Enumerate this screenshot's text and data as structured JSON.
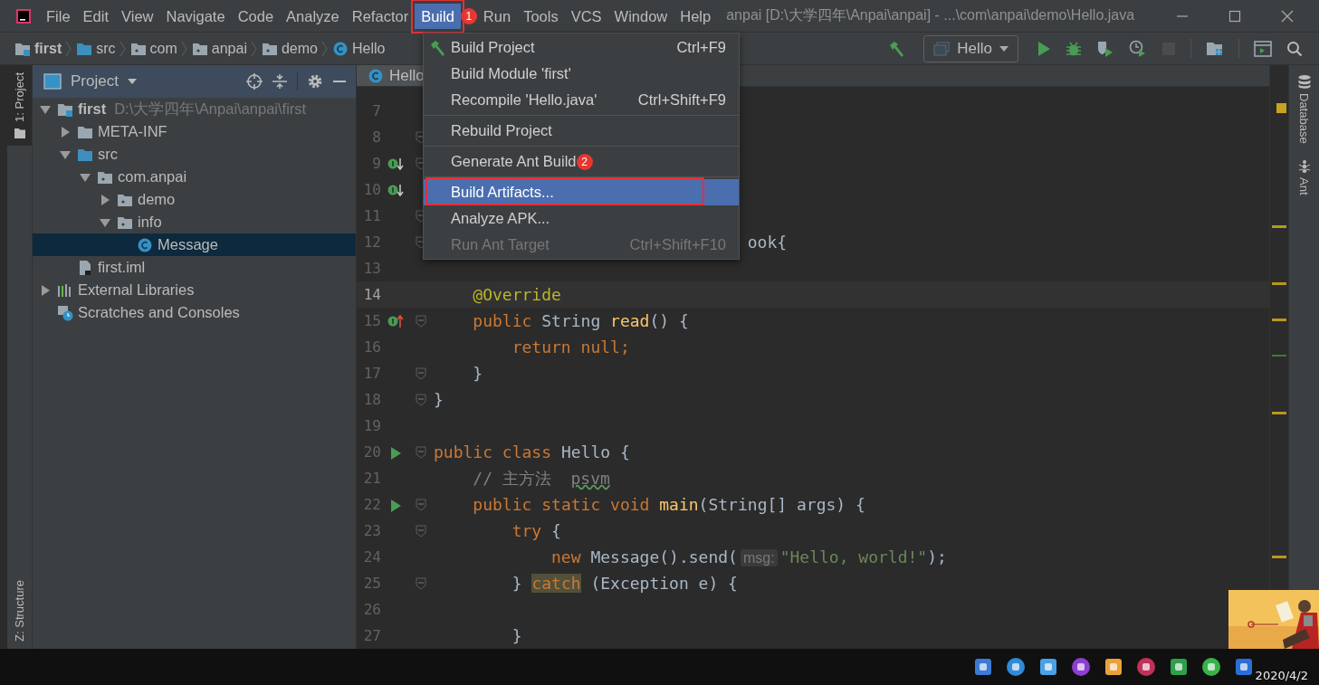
{
  "window": {
    "title": "anpai [D:\\大学四年\\Anpai\\anpai] - ...\\com\\anpai\\demo\\Hello.java"
  },
  "menu_bar": [
    {
      "label": "File",
      "selected": false
    },
    {
      "label": "Edit",
      "selected": false
    },
    {
      "label": "View",
      "selected": false
    },
    {
      "label": "Navigate",
      "selected": false
    },
    {
      "label": "Code",
      "selected": false
    },
    {
      "label": "Analyze",
      "selected": false
    },
    {
      "label": "Refactor",
      "selected": false
    },
    {
      "label": "Build",
      "selected": true,
      "outlined": true,
      "annotation": "1"
    },
    {
      "label": "Run",
      "selected": false
    },
    {
      "label": "Tools",
      "selected": false
    },
    {
      "label": "VCS",
      "selected": false
    },
    {
      "label": "Window",
      "selected": false
    },
    {
      "label": "Help",
      "selected": false
    }
  ],
  "breadcrumbs": [
    {
      "label": "first",
      "kind": "module"
    },
    {
      "label": "src",
      "kind": "source-folder"
    },
    {
      "label": "com",
      "kind": "package"
    },
    {
      "label": "anpai",
      "kind": "package"
    },
    {
      "label": "demo",
      "kind": "package"
    },
    {
      "label": "Hello",
      "kind": "class"
    }
  ],
  "run_configuration": {
    "label": "Hello"
  },
  "tool_stripes": {
    "left": [
      {
        "label": "1: Project",
        "selected": true
      },
      {
        "label": "Z: Structure",
        "selected": false
      }
    ],
    "right": [
      {
        "label": "Database",
        "kind": "database"
      },
      {
        "label": "Ant",
        "kind": "ant"
      }
    ]
  },
  "project_panel": {
    "title": "Project",
    "tree": [
      {
        "label": "first",
        "path": "D:\\大学四年\\Anpai\\anpai\\first",
        "kind": "module",
        "expanded": true,
        "selected": false,
        "children": [
          {
            "label": "META-INF",
            "kind": "folder",
            "expanded": false,
            "selected": false
          },
          {
            "label": "src",
            "kind": "source-folder",
            "expanded": true,
            "selected": false,
            "children": [
              {
                "label": "com.anpai",
                "kind": "package",
                "expanded": true,
                "selected": false,
                "children": [
                  {
                    "label": "demo",
                    "kind": "package",
                    "expanded": false,
                    "selected": false
                  },
                  {
                    "label": "info",
                    "kind": "package",
                    "expanded": true,
                    "selected": false,
                    "children": [
                      {
                        "label": "Message",
                        "kind": "class",
                        "selected": true
                      }
                    ]
                  }
                ]
              }
            ]
          },
          {
            "label": "first.iml",
            "kind": "file",
            "selected": false
          }
        ]
      },
      {
        "label": "External Libraries",
        "kind": "libraries",
        "expanded": false,
        "selected": false
      },
      {
        "label": "Scratches and Consoles",
        "kind": "scratches",
        "selected": false
      }
    ]
  },
  "editor": {
    "tabs": [
      {
        "label": "Hello",
        "selected": true
      }
    ],
    "lines": [
      {
        "number": "7",
        "fold": false,
        "current": false,
        "kind": "plain"
      },
      {
        "number": "8",
        "fold": true,
        "current": false,
        "kind": "plain"
      },
      {
        "number": "9",
        "fold": true,
        "current": false,
        "kind": "implemented"
      },
      {
        "number": "10",
        "fold": false,
        "current": false,
        "kind": "implemented"
      },
      {
        "number": "11",
        "fold": true,
        "current": false,
        "kind": "plain"
      },
      {
        "number": "12",
        "fold": true,
        "current": false,
        "kind": "plain",
        "tokens": [
          {
            "text": "                                ook{",
            "kind": "plain"
          }
        ]
      },
      {
        "number": "13",
        "fold": false,
        "current": false,
        "kind": "plain"
      },
      {
        "number": "14",
        "fold": false,
        "current": true,
        "kind": "plain",
        "tokens": [
          {
            "text": "    @Override",
            "kind": "annotation"
          }
        ]
      },
      {
        "number": "15",
        "fold": true,
        "current": false,
        "kind": "overrides",
        "tokens": [
          {
            "text": "    public ",
            "kind": "keyword"
          },
          {
            "text": "String ",
            "kind": "plain"
          },
          {
            "text": "read",
            "kind": "method"
          },
          {
            "text": "() {",
            "kind": "plain"
          }
        ]
      },
      {
        "number": "16",
        "fold": false,
        "current": false,
        "kind": "plain",
        "tokens": [
          {
            "text": "        return null;",
            "kind": "keyword"
          }
        ]
      },
      {
        "number": "17",
        "fold": true,
        "current": false,
        "kind": "plain",
        "tokens": [
          {
            "text": "    }",
            "kind": "plain"
          }
        ]
      },
      {
        "number": "18",
        "fold": true,
        "current": false,
        "kind": "plain",
        "tokens": [
          {
            "text": "}",
            "kind": "plain"
          }
        ]
      },
      {
        "number": "19",
        "fold": false,
        "current": false,
        "kind": "plain"
      },
      {
        "number": "20",
        "fold": true,
        "current": false,
        "kind": "run",
        "tokens": [
          {
            "text": "public class ",
            "kind": "keyword"
          },
          {
            "text": "Hello {",
            "kind": "plain"
          }
        ]
      },
      {
        "number": "21",
        "fold": false,
        "current": false,
        "kind": "plain",
        "tokens": [
          {
            "text": "    // 主方法  ",
            "kind": "comment"
          },
          {
            "text": "psvm",
            "kind": "typo"
          }
        ]
      },
      {
        "number": "22",
        "fold": true,
        "current": false,
        "kind": "run",
        "tokens": [
          {
            "text": "    public static void ",
            "kind": "keyword"
          },
          {
            "text": "main",
            "kind": "method"
          },
          {
            "text": "(String[] args) {",
            "kind": "plain"
          }
        ]
      },
      {
        "number": "23",
        "fold": true,
        "current": false,
        "kind": "plain",
        "tokens": [
          {
            "text": "        try ",
            "kind": "keyword"
          },
          {
            "text": "{",
            "kind": "plain"
          }
        ]
      },
      {
        "number": "24",
        "fold": false,
        "current": false,
        "kind": "plain",
        "tokens": [
          {
            "text": "            new ",
            "kind": "keyword"
          },
          {
            "text": "Message().send(",
            "kind": "plain"
          },
          {
            "text": "msg:",
            "kind": "hint"
          },
          {
            "text": "\"Hello, world!\"",
            "kind": "string"
          },
          {
            "text": ");",
            "kind": "plain"
          }
        ]
      },
      {
        "number": "25",
        "fold": true,
        "current": false,
        "kind": "plain",
        "tokens": [
          {
            "text": "        } ",
            "kind": "plain"
          },
          {
            "text": "catch",
            "kind": "keyword",
            "highlighted": true
          },
          {
            "text": " (Exception e) {",
            "kind": "plain"
          }
        ]
      },
      {
        "number": "26",
        "fold": false,
        "current": false,
        "kind": "plain"
      },
      {
        "number": "27",
        "fold": false,
        "current": false,
        "kind": "plain",
        "tokens": [
          {
            "text": "        }",
            "kind": "plain"
          }
        ]
      }
    ]
  },
  "build_menu": {
    "items": [
      {
        "kind": "item",
        "label": "Build Project",
        "shortcut": "Ctrl+F9",
        "selected": false,
        "disabled": false
      },
      {
        "kind": "item",
        "label": "Build Module 'first'",
        "selected": false,
        "disabled": false
      },
      {
        "kind": "item",
        "label": "Recompile 'Hello.java'",
        "shortcut": "Ctrl+Shift+F9",
        "selected": false,
        "disabled": false
      },
      {
        "kind": "separator"
      },
      {
        "kind": "item",
        "label": "Rebuild Project",
        "selected": false,
        "disabled": false
      },
      {
        "kind": "separator"
      },
      {
        "kind": "item",
        "label": "Generate Ant Build",
        "annotation": "2",
        "selected": false,
        "disabled": false
      },
      {
        "kind": "separator"
      },
      {
        "kind": "item",
        "label": "Build Artifacts...",
        "selected": true,
        "outlined": true,
        "disabled": false
      },
      {
        "kind": "item",
        "label": "Analyze APK...",
        "selected": false,
        "disabled": false
      },
      {
        "kind": "item",
        "label": "Run Ant Target",
        "shortcut": "Ctrl+Shift+F10",
        "selected": false,
        "disabled": true
      }
    ]
  },
  "taskbar": {
    "date": "2020/4/2"
  }
}
